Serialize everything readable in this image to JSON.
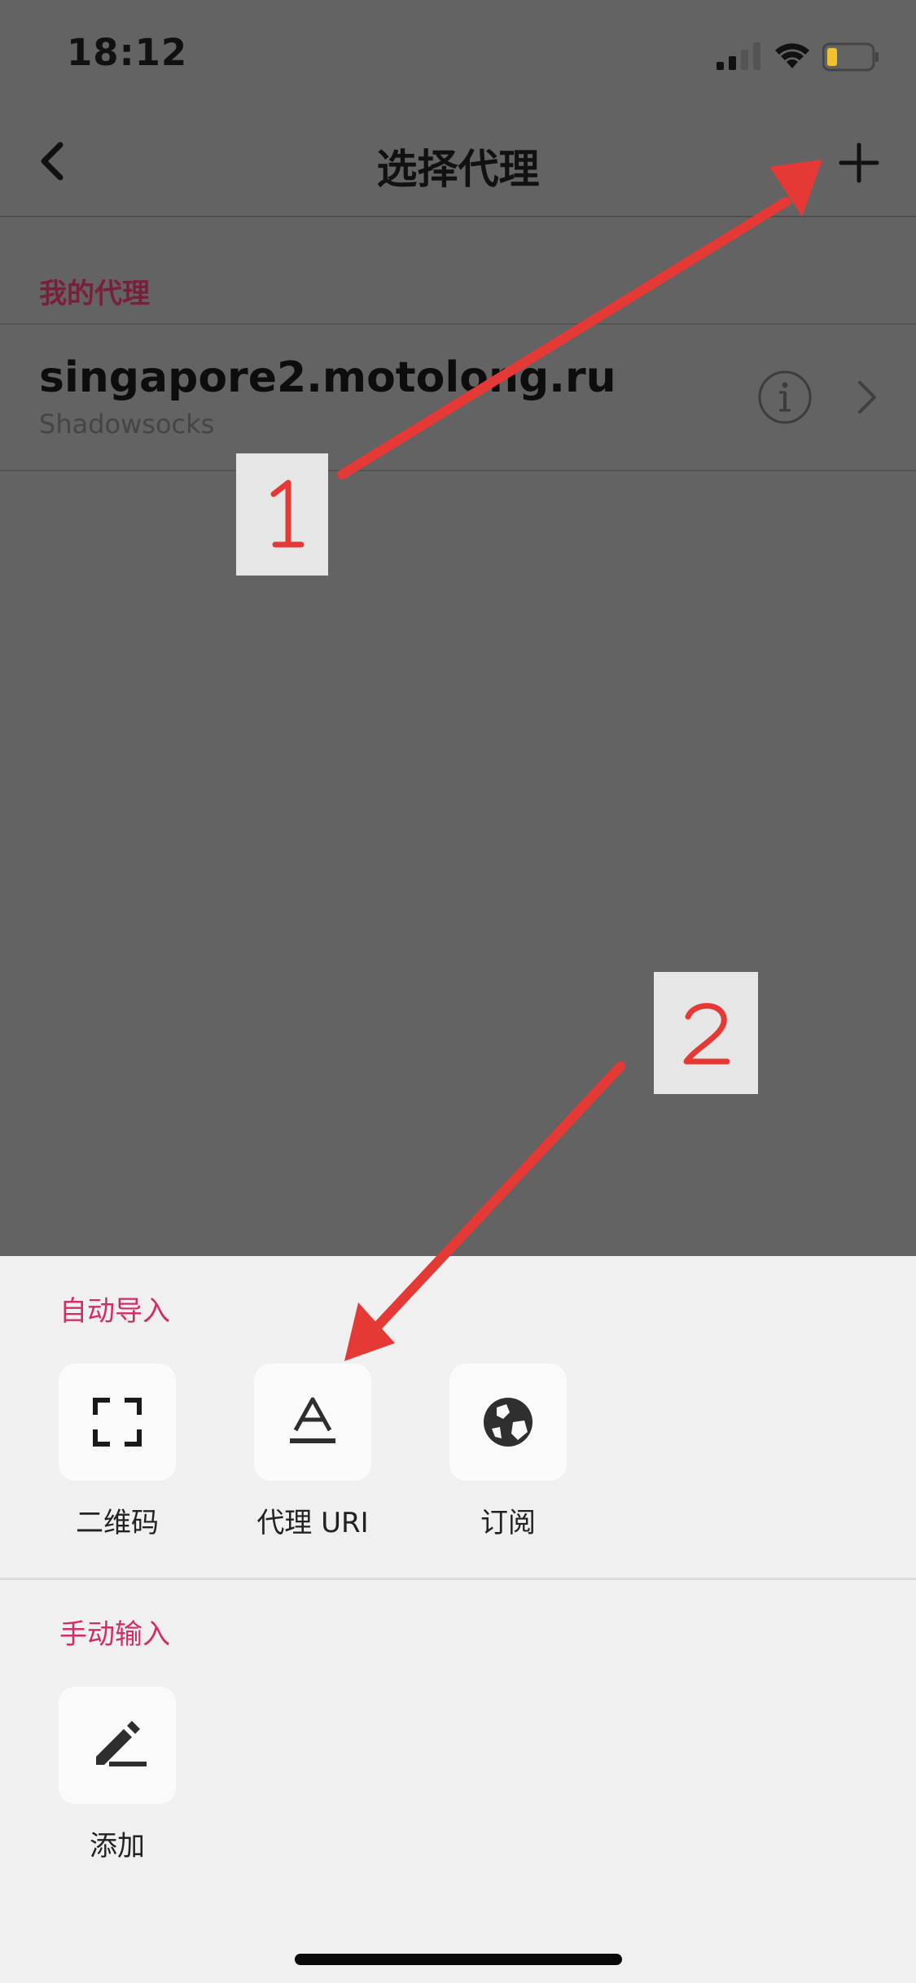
{
  "status_bar": {
    "time": "18:12"
  },
  "nav": {
    "title": "选择代理"
  },
  "my_proxies": {
    "section_label": "我的代理",
    "items": [
      {
        "host": "singapore2.motolong.ru",
        "type": "Shadowsocks"
      }
    ]
  },
  "sheet": {
    "auto_import": {
      "label": "自动导入",
      "options": [
        {
          "label": "二维码",
          "icon": "qr-scan-icon"
        },
        {
          "label": "代理 URI",
          "icon": "text-format-icon"
        },
        {
          "label": "订阅",
          "icon": "globe-icon"
        }
      ]
    },
    "manual_input": {
      "label": "手动输入",
      "options": [
        {
          "label": "添加",
          "icon": "pencil-icon"
        }
      ]
    }
  },
  "annotations": {
    "step1": "1",
    "step2": "2",
    "arrow_color": "#e53935",
    "text_color": "#e53935"
  },
  "colors": {
    "overlay": "#636363",
    "sheet_bg": "#f0f0f0",
    "accent": "#d12f64",
    "section_header_dim": "#7a1f3a"
  }
}
